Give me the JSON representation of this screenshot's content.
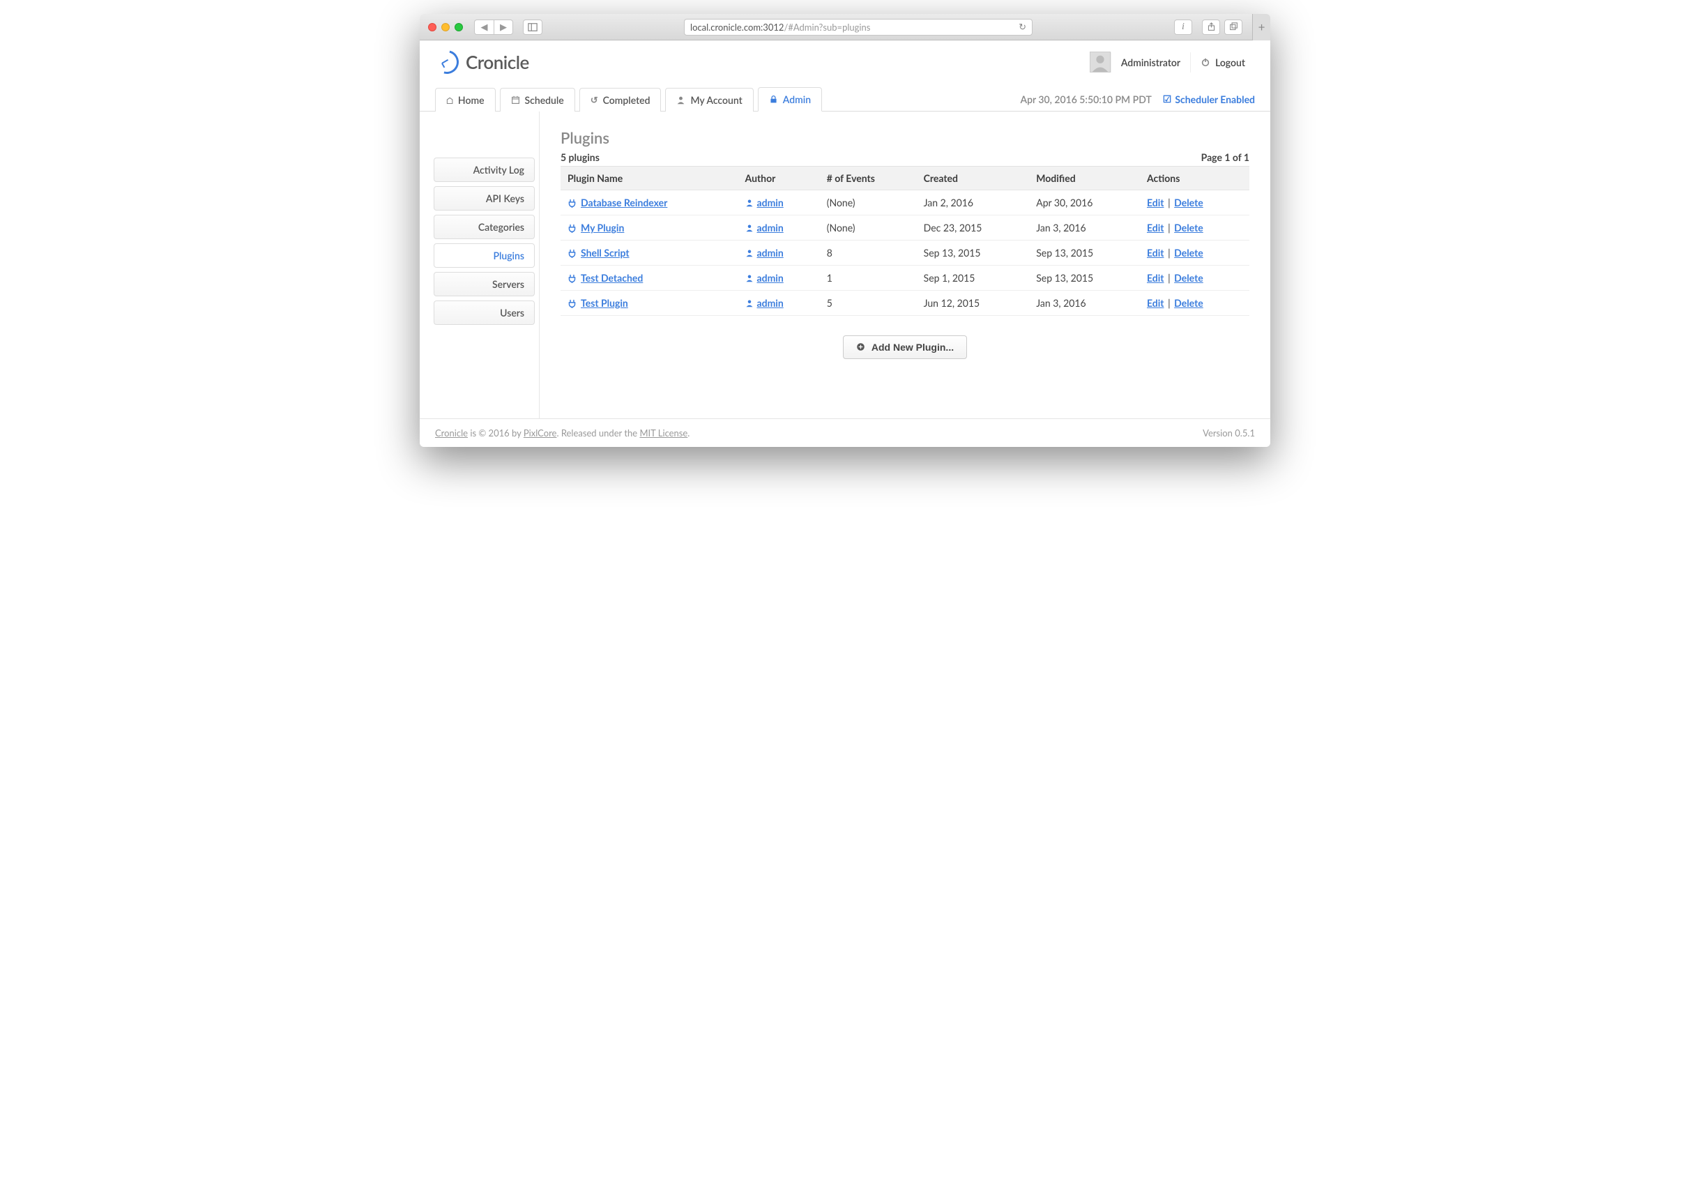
{
  "browser": {
    "url_host": "local.cronicle.com:3012",
    "url_path": "/#Admin?sub=plugins"
  },
  "header": {
    "app_name": "Cronicle",
    "user_label": "Administrator",
    "logout_label": "Logout"
  },
  "tabs": [
    {
      "label": "Home",
      "icon": "home-icon"
    },
    {
      "label": "Schedule",
      "icon": "calendar-icon"
    },
    {
      "label": "Completed",
      "icon": "history-icon"
    },
    {
      "label": "My Account",
      "icon": "user-icon"
    },
    {
      "label": "Admin",
      "icon": "lock-icon",
      "active": true
    }
  ],
  "tabbar": {
    "timestamp": "Apr 30, 2016 5:50:10 PM PDT",
    "scheduler_label": "Scheduler Enabled"
  },
  "sidebar": {
    "items": [
      {
        "label": "Activity Log"
      },
      {
        "label": "API Keys"
      },
      {
        "label": "Categories"
      },
      {
        "label": "Plugins",
        "active": true
      },
      {
        "label": "Servers"
      },
      {
        "label": "Users"
      }
    ]
  },
  "page": {
    "title": "Plugins",
    "count_label": "5 plugins",
    "page_label": "Page 1 of 1",
    "columns": [
      "Plugin Name",
      "Author",
      "# of Events",
      "Created",
      "Modified",
      "Actions"
    ],
    "rows": [
      {
        "name": "Database Reindexer",
        "author": "admin",
        "events": "(None)",
        "created": "Jan 2, 2016",
        "modified": "Apr 30, 2016"
      },
      {
        "name": "My Plugin",
        "author": "admin",
        "events": "(None)",
        "created": "Dec 23, 2015",
        "modified": "Jan 3, 2016"
      },
      {
        "name": "Shell Script",
        "author": "admin",
        "events": "8",
        "created": "Sep 13, 2015",
        "modified": "Sep 13, 2015"
      },
      {
        "name": "Test Detached",
        "author": "admin",
        "events": "1",
        "created": "Sep 1, 2015",
        "modified": "Sep 13, 2015"
      },
      {
        "name": "Test Plugin",
        "author": "admin",
        "events": "5",
        "created": "Jun 12, 2015",
        "modified": "Jan 3, 2016"
      }
    ],
    "action_edit": "Edit",
    "action_delete": "Delete",
    "add_button": "Add New Plugin..."
  },
  "footer": {
    "product": "Cronicle",
    "mid": " is © 2016 by ",
    "company": "PixlCore",
    "mid2": ". Released under the ",
    "license": "MIT License",
    "tail": ".",
    "version": "Version 0.5.1"
  }
}
